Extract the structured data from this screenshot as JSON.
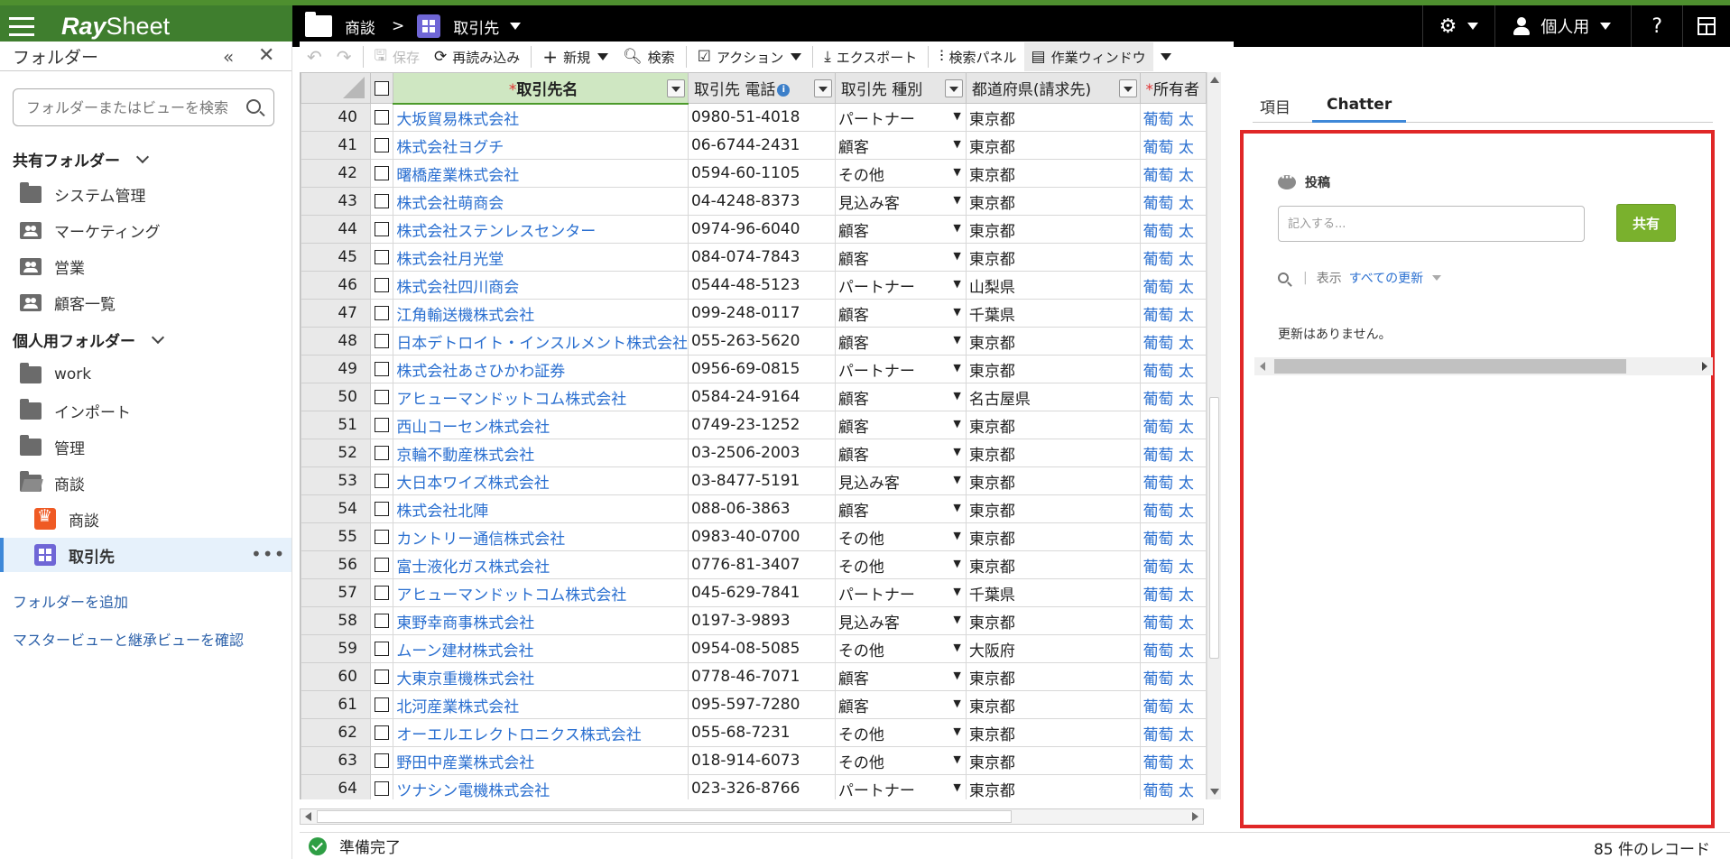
{
  "app": {
    "logo_ray": "Ray",
    "logo_sheet": "Sheet"
  },
  "breadcrumb": {
    "folder": "商談",
    "separator": ">",
    "view": "取引先"
  },
  "topbar": {
    "user_label": "個人用",
    "help": "?"
  },
  "sidebar": {
    "title": "フォルダー",
    "collapse": "«",
    "close": "✕",
    "search_placeholder": "フォルダーまたはビューを検索",
    "shared_section": "共有フォルダー",
    "shared_items": [
      "システム管理",
      "マーケティング",
      "営業",
      "顧客一覧"
    ],
    "personal_section": "個人用フォルダー",
    "personal_items": [
      "work",
      "インポート",
      "管理",
      "商談"
    ],
    "sub_items": [
      "商談",
      "取引先"
    ],
    "more": "•••",
    "add_folder": "フォルダーを追加",
    "master_link": "マスタービューと継承ビューを確認"
  },
  "toolbar": {
    "undo": "↶",
    "redo": "↷",
    "save": "保存",
    "reload": "再読み込み",
    "new": "新規",
    "search": "検索",
    "action": "アクション",
    "export": "エクスポート",
    "search_panel": "検索パネル",
    "work_window": "作業ウィンドウ"
  },
  "grid": {
    "headers": {
      "name": "取引先名",
      "phone": "取引先 電話",
      "type": "取引先 種別",
      "pref": "都道府県(請求先)",
      "owner": "所有者"
    },
    "rows": [
      {
        "n": "40",
        "name": "大坂貿易株式会社",
        "phone": "0980-51-4018",
        "type": "パートナー",
        "pref": "東京都",
        "owner": "葡萄 太"
      },
      {
        "n": "41",
        "name": "株式会社ヨグチ",
        "phone": "06-6744-2431",
        "type": "顧客",
        "pref": "東京都",
        "owner": "葡萄 太"
      },
      {
        "n": "42",
        "name": "曙橋産業株式会社",
        "phone": "0594-60-1105",
        "type": "その他",
        "pref": "東京都",
        "owner": "葡萄 太"
      },
      {
        "n": "43",
        "name": "株式会社萌商会",
        "phone": "04-4248-8373",
        "type": "見込み客",
        "pref": "東京都",
        "owner": "葡萄 太"
      },
      {
        "n": "44",
        "name": "株式会社ステンレスセンター",
        "phone": "0974-96-6040",
        "type": "顧客",
        "pref": "東京都",
        "owner": "葡萄 太"
      },
      {
        "n": "45",
        "name": "株式会社月光堂",
        "phone": "084-074-7843",
        "type": "顧客",
        "pref": "東京都",
        "owner": "葡萄 太"
      },
      {
        "n": "46",
        "name": "株式会社四川商会",
        "phone": "0544-48-5123",
        "type": "パートナー",
        "pref": "山梨県",
        "owner": "葡萄 太"
      },
      {
        "n": "47",
        "name": "江角輸送機株式会社",
        "phone": "099-248-0117",
        "type": "顧客",
        "pref": "千葉県",
        "owner": "葡萄 太"
      },
      {
        "n": "48",
        "name": "日本デトロイト・インスルメント株式会社",
        "phone": "055-263-5620",
        "type": "顧客",
        "pref": "東京都",
        "owner": "葡萄 太"
      },
      {
        "n": "49",
        "name": "株式会社あさひかわ証券",
        "phone": "0956-69-0815",
        "type": "パートナー",
        "pref": "東京都",
        "owner": "葡萄 太"
      },
      {
        "n": "50",
        "name": "アヒューマンドットコム株式会社",
        "phone": "0584-24-9164",
        "type": "顧客",
        "pref": "名古屋県",
        "owner": "葡萄 太"
      },
      {
        "n": "51",
        "name": "西山コーセン株式会社",
        "phone": "0749-23-1252",
        "type": "顧客",
        "pref": "東京都",
        "owner": "葡萄 太"
      },
      {
        "n": "52",
        "name": "京輪不動産株式会社",
        "phone": "03-2506-2003",
        "type": "顧客",
        "pref": "東京都",
        "owner": "葡萄 太"
      },
      {
        "n": "53",
        "name": "大日本ワイズ株式会社",
        "phone": "03-8477-5191",
        "type": "見込み客",
        "pref": "東京都",
        "owner": "葡萄 太"
      },
      {
        "n": "54",
        "name": "株式会社北陣",
        "phone": "088-06-3863",
        "type": "顧客",
        "pref": "東京都",
        "owner": "葡萄 太"
      },
      {
        "n": "55",
        "name": "カントリー通信株式会社",
        "phone": "0983-40-0700",
        "type": "その他",
        "pref": "東京都",
        "owner": "葡萄 太"
      },
      {
        "n": "56",
        "name": "富士液化ガス株式会社",
        "phone": "0776-81-3407",
        "type": "その他",
        "pref": "東京都",
        "owner": "葡萄 太"
      },
      {
        "n": "57",
        "name": "アヒューマンドットコム株式会社",
        "phone": "045-629-7841",
        "type": "パートナー",
        "pref": "千葉県",
        "owner": "葡萄 太"
      },
      {
        "n": "58",
        "name": "東野幸商事株式会社",
        "phone": "0197-3-9893",
        "type": "見込み客",
        "pref": "東京都",
        "owner": "葡萄 太"
      },
      {
        "n": "59",
        "name": "ムーン建材株式会社",
        "phone": "0954-08-5085",
        "type": "その他",
        "pref": "大阪府",
        "owner": "葡萄 太"
      },
      {
        "n": "60",
        "name": "大東京重機株式会社",
        "phone": "0778-46-7071",
        "type": "顧客",
        "pref": "東京都",
        "owner": "葡萄 太"
      },
      {
        "n": "61",
        "name": "北河産業株式会社",
        "phone": "095-597-7280",
        "type": "顧客",
        "pref": "東京都",
        "owner": "葡萄 太"
      },
      {
        "n": "62",
        "name": "オーエルエレクトロニクス株式会社",
        "phone": "055-68-7231",
        "type": "その他",
        "pref": "東京都",
        "owner": "葡萄 太"
      },
      {
        "n": "63",
        "name": "野田中産業株式会社",
        "phone": "018-914-6073",
        "type": "その他",
        "pref": "東京都",
        "owner": "葡萄 太"
      },
      {
        "n": "64",
        "name": "ツナシン電機株式会社",
        "phone": "023-326-8766",
        "type": "パートナー",
        "pref": "東京都",
        "owner": "葡萄 太"
      }
    ]
  },
  "panel": {
    "tab_fields": "項目",
    "tab_chatter": "Chatter",
    "post_label": "投稿",
    "post_placeholder": "記入する...",
    "share_button": "共有",
    "pipe": "|",
    "show_label": "表示",
    "filter_value": "すべての更新",
    "no_updates": "更新はありません。"
  },
  "status": {
    "ready": "準備完了",
    "record_count": "85 件のレコード"
  },
  "colors": {
    "brand_green": "#3f7e2e",
    "link_blue": "#2a6fd0",
    "share_green": "#7ab12d",
    "focus_red": "#e02727"
  }
}
